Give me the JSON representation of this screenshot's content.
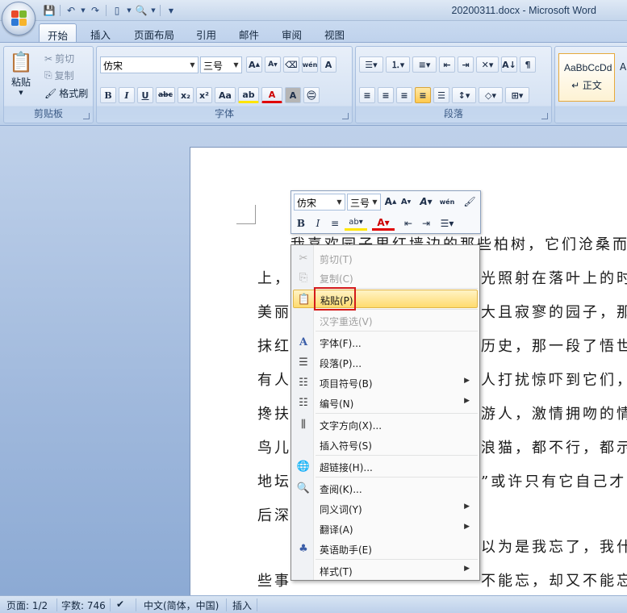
{
  "window": {
    "title": "20200311.docx - Microsoft Word"
  },
  "quick_access": {
    "icons": [
      "save-icon",
      "undo-icon",
      "redo-icon",
      "new-doc-icon",
      "print-preview-icon",
      "customize-icon"
    ]
  },
  "tabs": [
    {
      "label": "开始",
      "active": true
    },
    {
      "label": "插入"
    },
    {
      "label": "页面布局"
    },
    {
      "label": "引用"
    },
    {
      "label": "邮件"
    },
    {
      "label": "审阅"
    },
    {
      "label": "视图"
    }
  ],
  "ribbon": {
    "clipboard": {
      "label": "剪贴板",
      "paste": "粘贴",
      "cut": "剪切",
      "copy": "复制",
      "format_painter": "格式刷"
    },
    "font": {
      "label": "字体",
      "font_name": "仿宋",
      "font_size": "三号"
    },
    "paragraph": {
      "label": "段落"
    },
    "styles": {
      "sample": "AaBbCcDd",
      "name": "↵ 正文",
      "sample2": "A"
    }
  },
  "mini_toolbar": {
    "font_name": "仿宋",
    "font_size": "三号"
  },
  "document": {
    "lines": [
      "我喜欢园子里红墙边的那些柏树，它们沧桑而",
      "上，",
      "光照射在落叶上的时",
      "美丽",
      "大且寂寥的园子，那",
      "抹红",
      "历史，那一段了悟世",
      "有人",
      "人打扰惊吓到它们，",
      "搀扶",
      "游人，激情拥吻的情",
      "鸟儿",
      "浪猫，都不行，都示",
      "地坛",
      "”或许只有它自己才",
      "后深",
      "以为是我忘了，我什",
      "些事",
      "不能忘，却又不能忘"
    ]
  },
  "context_menu": {
    "items": [
      {
        "label": "剪切(T)",
        "icon": "scissors-icon",
        "disabled": true
      },
      {
        "label": "复制(C)",
        "icon": "copy-icon",
        "disabled": true
      },
      {
        "label": "粘贴(P)",
        "icon": "paste-icon",
        "highlighted": true
      },
      {
        "label": "汉字重选(V)",
        "disabled": true
      },
      {
        "label": "字体(F)...",
        "icon": "font-icon"
      },
      {
        "label": "段落(P)...",
        "icon": "paragraph-icon"
      },
      {
        "label": "项目符号(B)",
        "icon": "bullets-icon",
        "submenu": true
      },
      {
        "label": "编号(N)",
        "icon": "numbering-icon",
        "submenu": true
      },
      {
        "label": "文字方向(X)...",
        "icon": "text-direction-icon"
      },
      {
        "label": "插入符号(S)"
      },
      {
        "label": "超链接(H)...",
        "icon": "hyperlink-icon"
      },
      {
        "label": "查阅(K)...",
        "icon": "research-icon"
      },
      {
        "label": "同义词(Y)",
        "submenu": true
      },
      {
        "label": "翻译(A)",
        "submenu": true
      },
      {
        "label": "英语助手(E)",
        "icon": "english-assistant-icon"
      },
      {
        "label": "样式(T)",
        "submenu": true
      }
    ]
  },
  "statusbar": {
    "page": "页面: 1/2",
    "words": "字数: 746",
    "language": "中文(简体，中国)",
    "mode": "插入"
  }
}
